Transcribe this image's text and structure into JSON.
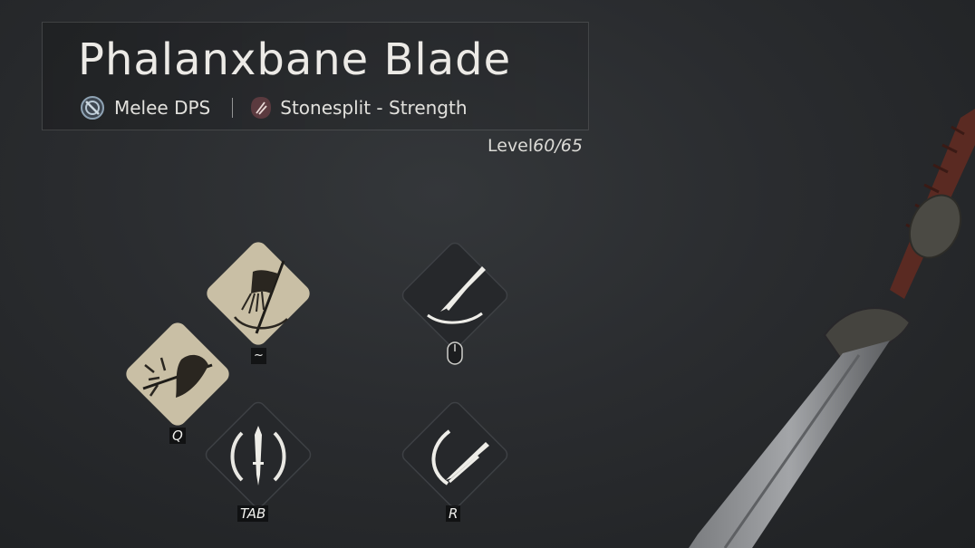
{
  "weapon": {
    "name": "Phalanxbane Blade",
    "role": "Melee DPS",
    "martial_art": "Stonesplit - Strength",
    "level_label": "Level",
    "level_value": "60/65",
    "role_icon": "crossed-circle-icon",
    "martial_art_icon": "stonesplit-icon"
  },
  "skills": [
    {
      "id": "special-banner",
      "key": "~",
      "style": "parchment",
      "icon": "banner-spear-icon"
    },
    {
      "id": "martial-q",
      "key": "Q",
      "style": "parchment",
      "icon": "spear-thrust-icon"
    },
    {
      "id": "attack",
      "key": "mouse",
      "style": "dark",
      "icon": "slash-icon"
    },
    {
      "id": "tab",
      "key": "TAB",
      "style": "dark",
      "icon": "blade-stance-icon"
    },
    {
      "id": "r",
      "key": "R",
      "style": "dark",
      "icon": "crescent-strike-icon"
    }
  ],
  "colors": {
    "parchment": "#c9bfa5",
    "dark_tile": "#2b2d30",
    "background": "#2a2c2f"
  }
}
